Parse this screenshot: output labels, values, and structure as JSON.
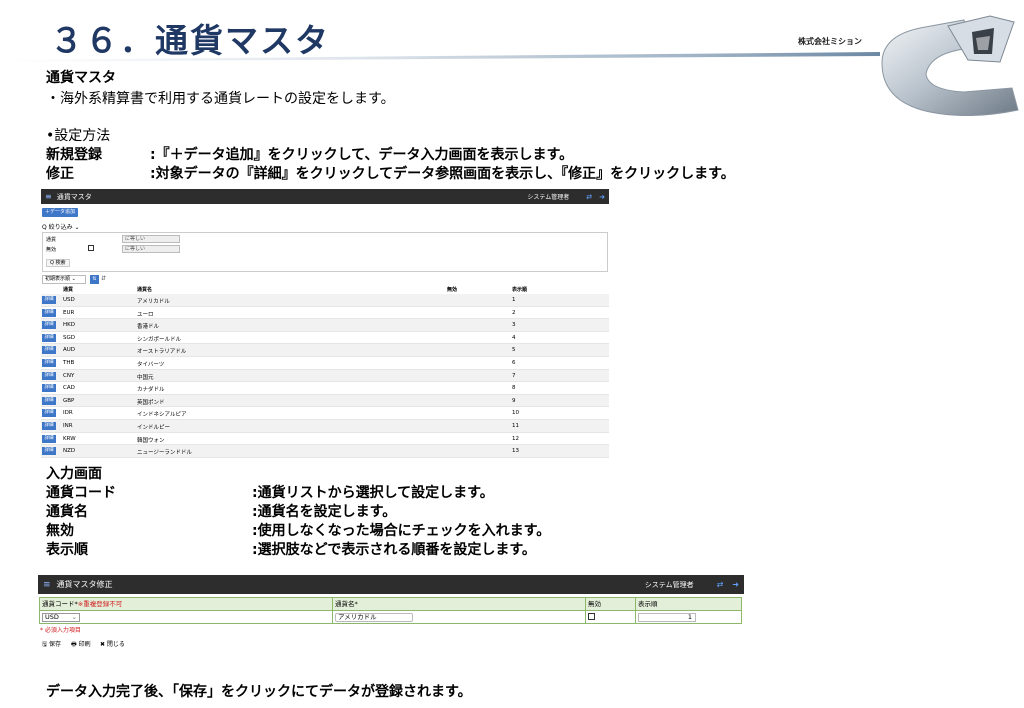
{
  "header": {
    "title": "３６．通貨マスタ",
    "company": "株式会社ミション"
  },
  "intro": {
    "heading": "通貨マスタ",
    "desc": "・海外系精算書で利用する通貨レートの設定をします。"
  },
  "method": {
    "label": "•設定方法",
    "items": [
      {
        "term": "新規登録",
        "desc": ":『＋データ追加』をクリックして、データ入力画面を表示します。"
      },
      {
        "term": "修正",
        "desc": ":対象データの『詳細』をクリックしてデータ参照画面を表示し、『修正』をクリックします。"
      }
    ]
  },
  "list_app": {
    "title": "通貨マスタ",
    "user": "システム管理者",
    "add_button": "＋データ追加",
    "filter_label": "Q 絞り込み ⌄",
    "filter": {
      "currency_label": "通貨",
      "currency_op": "に等しい",
      "invalid_label": "無効",
      "invalid_op": "に等しい",
      "search_button": "Q 検索"
    },
    "sort_select": "初期表示順 ⌄",
    "columns": {
      "code": "通貨",
      "name": "通貨名",
      "invalid": "無効",
      "order": "表示順"
    },
    "detail_label": "詳細",
    "rows": [
      {
        "code": "USD",
        "name": "アメリカドル",
        "order": "1"
      },
      {
        "code": "EUR",
        "name": "ユーロ",
        "order": "2"
      },
      {
        "code": "HKD",
        "name": "香港ドル",
        "order": "3"
      },
      {
        "code": "SGD",
        "name": "シンガポールドル",
        "order": "4"
      },
      {
        "code": "AUD",
        "name": "オーストラリアドル",
        "order": "5"
      },
      {
        "code": "THB",
        "name": "タイバーツ",
        "order": "6"
      },
      {
        "code": "CNY",
        "name": "中国元",
        "order": "7"
      },
      {
        "code": "CAD",
        "name": "カナダドル",
        "order": "8"
      },
      {
        "code": "GBP",
        "name": "英国ポンド",
        "order": "9"
      },
      {
        "code": "IDR",
        "name": "インドネシアルピア",
        "order": "10"
      },
      {
        "code": "INR",
        "name": "インドルピー",
        "order": "11"
      },
      {
        "code": "KRW",
        "name": "韓国ウォン",
        "order": "12"
      },
      {
        "code": "NZD",
        "name": "ニュージーランドドル",
        "order": "13"
      }
    ]
  },
  "input_section": {
    "heading": "入力画面",
    "fields": [
      {
        "term": "通貨コード",
        "desc": ":通貨リストから選択して設定します。"
      },
      {
        "term": "通貨名",
        "desc": ":通貨名を設定します。"
      },
      {
        "term": "無効",
        "desc": ":使用しなくなった場合にチェックを入れます。"
      },
      {
        "term": "表示順",
        "desc": ":選択肢などで表示される順番を設定します。"
      }
    ]
  },
  "edit_app": {
    "title": "通貨マスタ修正",
    "user": "システム管理者",
    "col_code": "通貨コード*",
    "col_code_note": "※重複登録不可",
    "col_name": "通貨名*",
    "col_invalid": "無効",
    "col_order": "表示順",
    "code_value": "USD",
    "name_value": "アメリカドル",
    "order_value": "1",
    "required_note": "* 必須入力項目",
    "save": "🖫 保存",
    "print": "🖶 印刷",
    "close": "✖ 閉じる"
  },
  "footer": "データ入力完了後、「保存」をクリックにてデータが登録されます。",
  "colors": {
    "title": "#1f3864",
    "accent": "#3f77c8",
    "bar": "#2d2d2d"
  }
}
